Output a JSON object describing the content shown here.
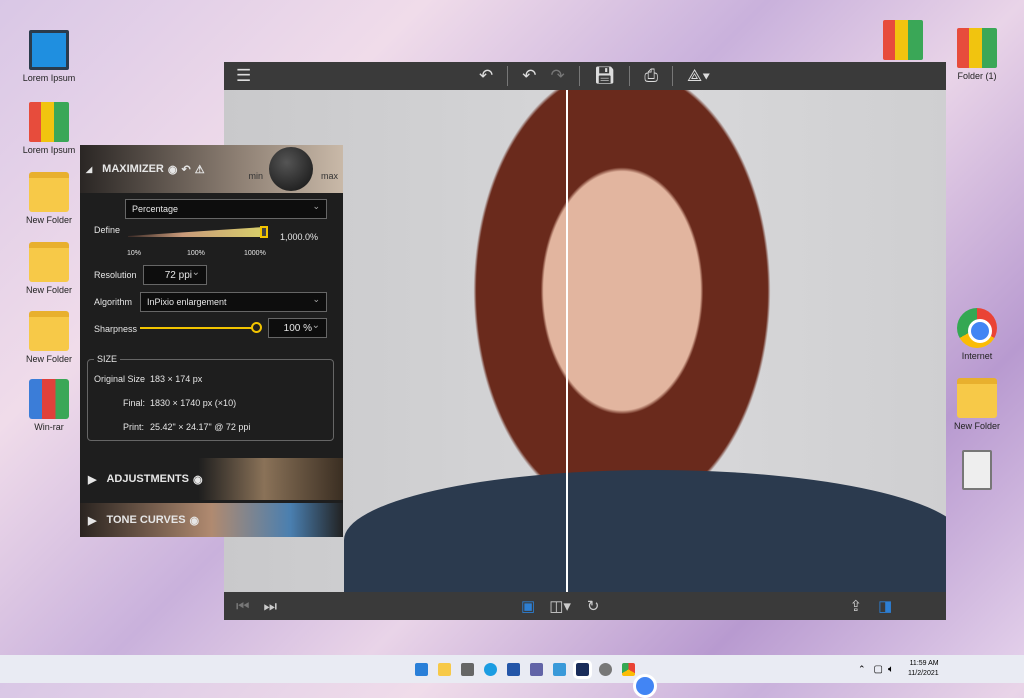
{
  "desktop": {
    "left": [
      "Lorem Ipsum",
      "Lorem Ipsum",
      "New Folder",
      "New Folder",
      "New Folder",
      "Win-rar"
    ],
    "right": [
      "Folder (1)",
      "Internet",
      "New Folder"
    ]
  },
  "maximizer": {
    "title": "MAXIMIZER",
    "knob_min": "min",
    "knob_max": "max",
    "mode": "Percentage",
    "define_label": "Define",
    "define_value": "1,000.0%",
    "define_percent": 100,
    "ticks": [
      "10%",
      "100%",
      "1000%"
    ],
    "resolution_label": "Resolution",
    "resolution": "72 ppi",
    "algorithm_label": "Algorithm",
    "algorithm": "InPixio enlargement",
    "sharpness_label": "Sharpness",
    "sharpness": "100 %",
    "size": {
      "title": "SIZE",
      "original_label": "Original Size",
      "original": "183 × 174 px",
      "final_label": "Final:",
      "final": "1830 × 1740 px (×10)",
      "print_label": "Print:",
      "print": "25.42\" × 24.17\" @ 72 ppi"
    }
  },
  "sections": [
    "ADJUSTMENTS",
    "TONE CURVES"
  ],
  "clock": {
    "time": "11:59 AM",
    "date": "11/2/2021"
  },
  "accent": "#f2c400"
}
